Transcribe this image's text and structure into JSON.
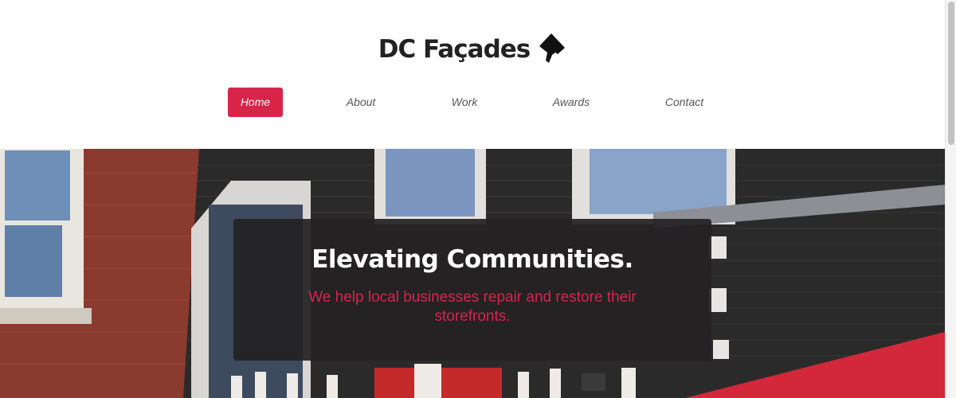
{
  "brand": {
    "title": "DC Façades",
    "icon": "dc-map-icon"
  },
  "nav": {
    "items": [
      {
        "label": "Home",
        "active": true
      },
      {
        "label": "About",
        "active": false
      },
      {
        "label": "Work",
        "active": false
      },
      {
        "label": "Awards",
        "active": false
      },
      {
        "label": "Contact",
        "active": false
      }
    ]
  },
  "hero": {
    "title": "Elevating Communities.",
    "subtitle": "We help local businesses repair and restore their storefronts."
  },
  "colors": {
    "accent": "#d9244a",
    "text_dark": "#222222",
    "overlay": "#232122"
  }
}
